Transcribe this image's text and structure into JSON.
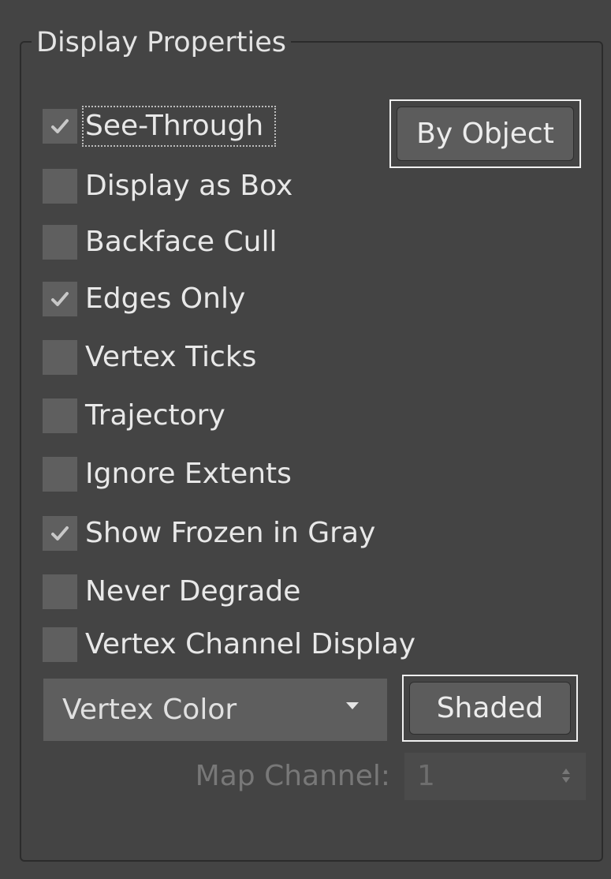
{
  "group": {
    "title": "Display Properties"
  },
  "checkboxes": [
    {
      "label": "See-Through",
      "checked": true,
      "focused": true
    },
    {
      "label": "Display as Box",
      "checked": false
    },
    {
      "label": "Backface Cull",
      "checked": false
    },
    {
      "label": "Edges Only",
      "checked": true
    },
    {
      "label": "Vertex Ticks",
      "checked": false
    },
    {
      "label": "Trajectory",
      "checked": false
    },
    {
      "label": "Ignore Extents",
      "checked": false
    },
    {
      "label": "Show Frozen in Gray",
      "checked": true
    },
    {
      "label": "Never Degrade",
      "checked": false
    },
    {
      "label": "Vertex Channel Display",
      "checked": false
    }
  ],
  "buttons": {
    "by_object": "By Object",
    "shaded": "Shaded"
  },
  "vertex_dropdown": {
    "value": "Vertex Color"
  },
  "map_channel": {
    "label": "Map Channel:",
    "value": "1",
    "enabled": false
  },
  "colors": {
    "panel_bg": "#444444",
    "checkbox_bg": "#5f5f5f",
    "check_mark": "#c8c8c8",
    "button_highlight": "#f0f0f0",
    "disabled_text": "#787878"
  },
  "icons": {
    "check": "check-mark-icon",
    "dropdown": "chevron-down-icon",
    "spinner": "spinner-arrows-icon"
  }
}
